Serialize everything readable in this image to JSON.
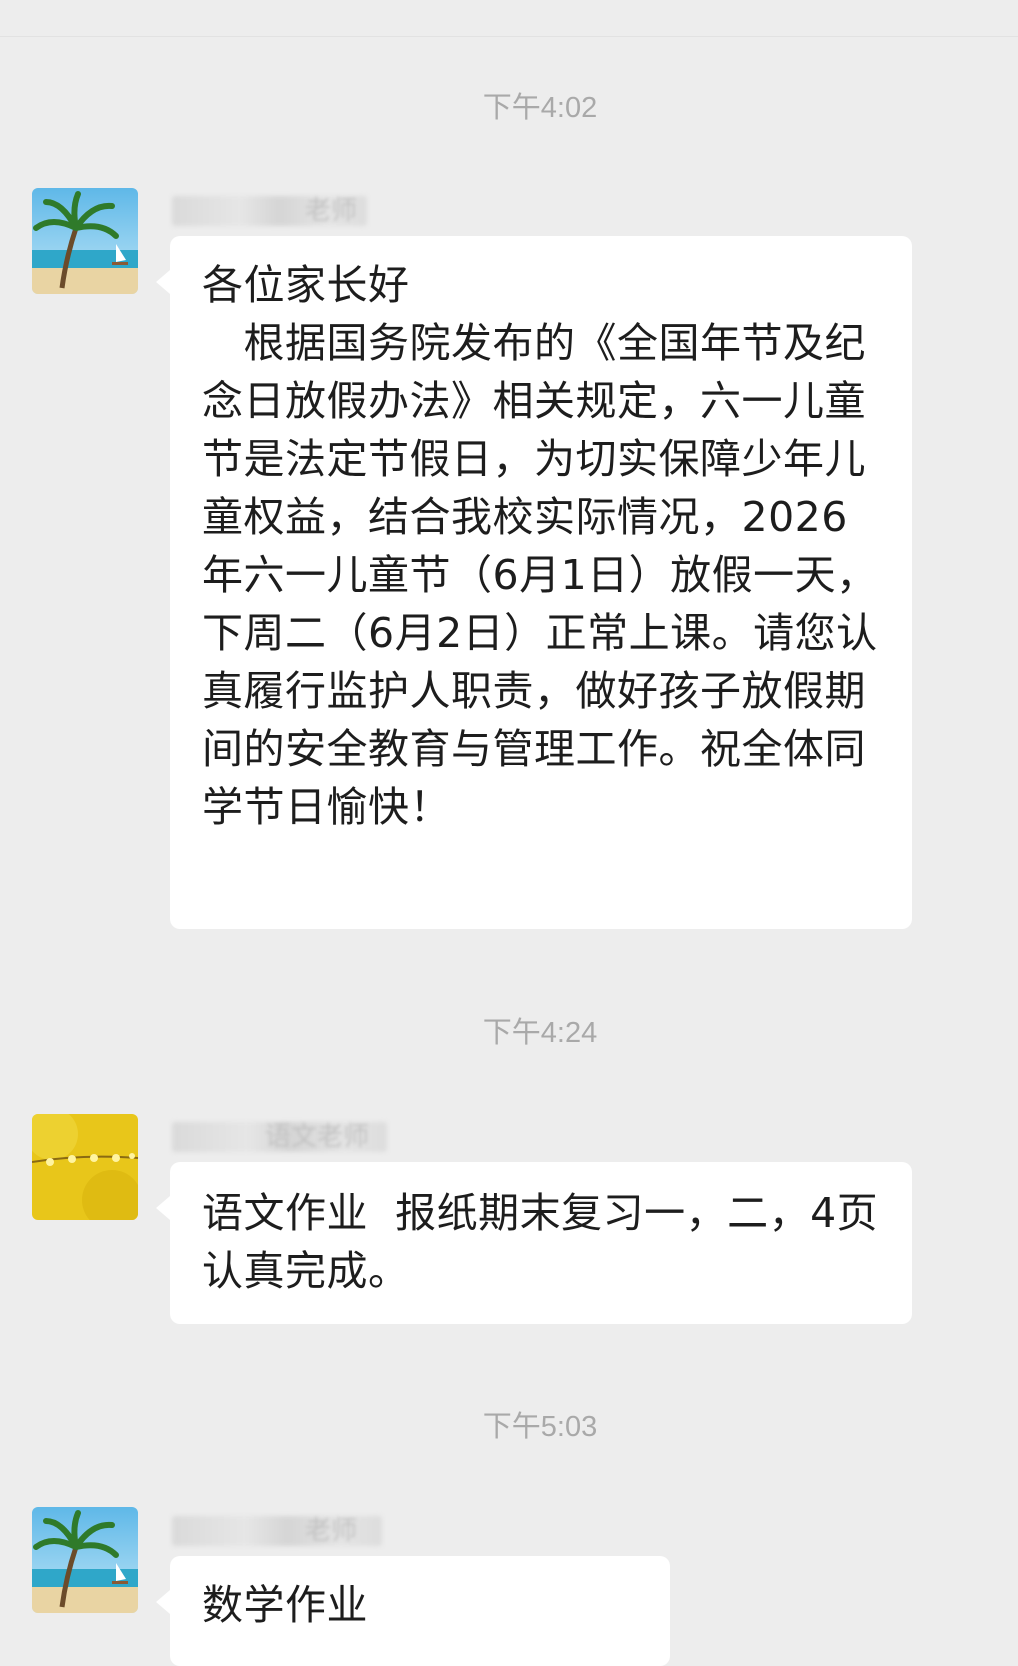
{
  "messages": [
    {
      "time": "下午4:02",
      "sender_visible": "老师",
      "avatar": "beach-palm-avatar",
      "text": "各位家长好\n　根据国务院发布的《全国年节及纪念日放假办法》相关规定，六一儿童节是法定节假日，为切实保障少年儿童权益，结合我校实际情况，2026年六一儿童节（6月1日）放假一天，下周二（6月2日）正常上课。请您认真履行监护人职责，做好孩子放假期间的安全教育与管理工作。祝全体同学节日愉快！"
    },
    {
      "time": "下午4:24",
      "sender_visible": "语文老师",
      "avatar": "yellow-flowers-avatar",
      "text": "语文作业  报纸期末复习一，二，4页认真完成。"
    },
    {
      "time": "下午5:03",
      "sender_visible": "老师",
      "avatar": "beach-palm-avatar",
      "text": "数学作业"
    }
  ]
}
